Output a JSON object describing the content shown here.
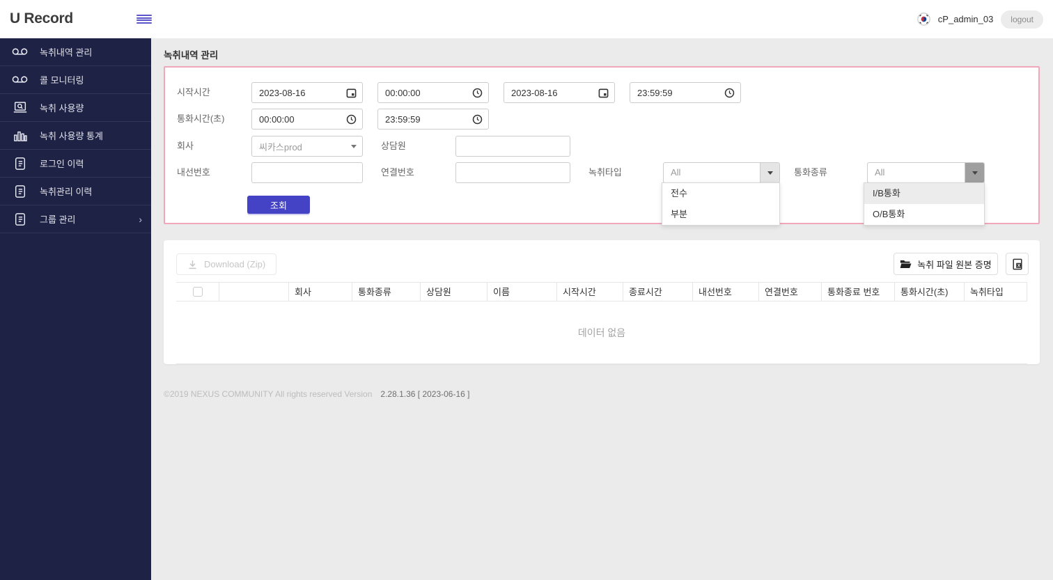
{
  "header": {
    "app_title": "U Record",
    "username": "cP_admin_03",
    "logout_label": "logout"
  },
  "sidebar": {
    "items": [
      {
        "label": "녹취내역 관리",
        "icon": "voicemail-icon"
      },
      {
        "label": "콜 모니터링",
        "icon": "voicemail-icon"
      },
      {
        "label": "녹취 사용량",
        "icon": "usage-search-icon"
      },
      {
        "label": "녹취 사용량 통계",
        "icon": "bar-chart-icon"
      },
      {
        "label": "로그인 이력",
        "icon": "document-icon"
      },
      {
        "label": "녹취관리 이력",
        "icon": "document-icon"
      },
      {
        "label": "그룹 관리",
        "icon": "document-icon"
      }
    ]
  },
  "page": {
    "title": "녹취내역 관리"
  },
  "search": {
    "start_label": "시작시간",
    "date_from": "2023-08-16",
    "time_from": "00:00:00",
    "date_to": "2023-08-16",
    "time_to": "23:59:59",
    "duration_label": "통화시간(초)",
    "duration_from": "00:00:00",
    "duration_to": "23:59:59",
    "company_label": "회사",
    "company_value": "씨카스prod",
    "agent_label": "상담원",
    "extension_label": "내선번호",
    "connection_label": "연결번호",
    "rectype_label": "녹취타입",
    "rectype_value": "All",
    "rectype_options": [
      "전수",
      "부분"
    ],
    "calltype_label": "통화종류",
    "calltype_value": "All",
    "calltype_options": [
      "I/B통화",
      "O/B통화"
    ],
    "submit_label": "조회"
  },
  "results": {
    "download_label": "Download (Zip)",
    "proof_label": "녹취 파일 원본 증명",
    "columns": [
      "회사",
      "통화종류",
      "상담원",
      "이름",
      "시작시간",
      "종료시간",
      "내선번호",
      "연결번호",
      "통화종료 번호",
      "통화시간(초)",
      "녹취타입"
    ],
    "empty_message": "데이터 없음"
  },
  "footer": {
    "copyright": "©2019 NEXUS COMMUNITY All rights reserved Version",
    "version": "2.28.1.36 [ 2023-06-16 ]"
  },
  "colors": {
    "accent": "#4543c5",
    "sidebar_bg": "#1e2245",
    "panel_border": "#f2a6ba",
    "highlight": "#ececec"
  }
}
